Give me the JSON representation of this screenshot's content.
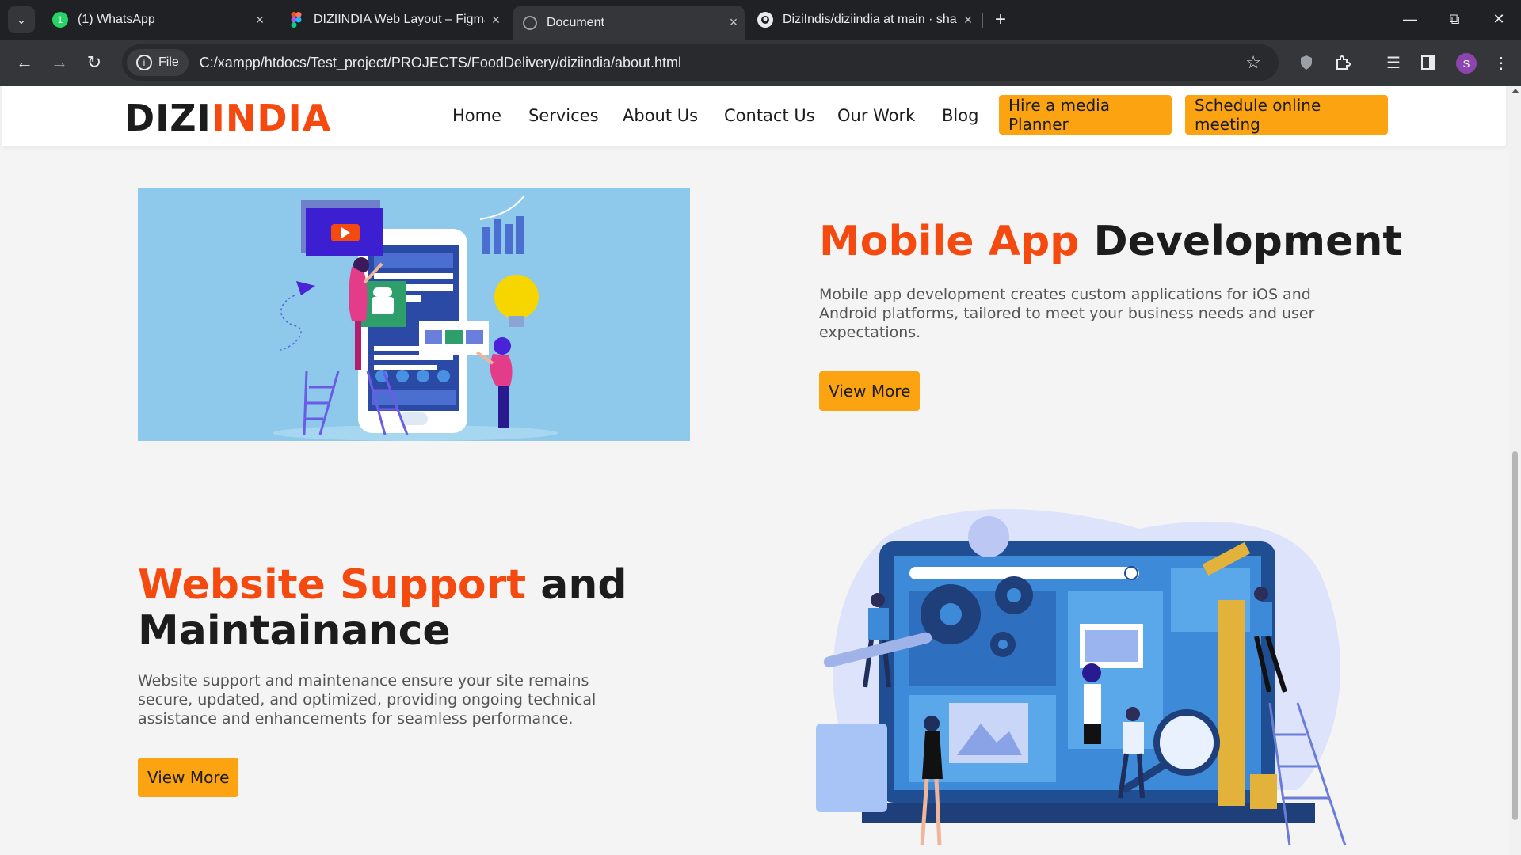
{
  "browser": {
    "tabs": [
      {
        "title": "(1) WhatsApp",
        "icon": "whatsapp-icon",
        "active": false
      },
      {
        "title": "DIZIINDIA Web Layout – Figma",
        "icon": "figma-icon",
        "active": false
      },
      {
        "title": "Document",
        "icon": "globe-icon",
        "active": true
      },
      {
        "title": "DiziIndis/diziindia at main · shar",
        "icon": "github-icon",
        "active": false
      }
    ],
    "new_tab": "+",
    "chip_label": "File",
    "url": "C:/xampp/htdocs/Test_project/PROJECTS/FoodDelivery/diziindia/about.html",
    "profile_initial": "S",
    "whatsapp_badge": "1"
  },
  "site": {
    "logo_part1": "DIZI",
    "logo_part2": "INDIA",
    "nav": [
      "Home",
      "Services",
      "About Us",
      "Contact Us",
      "Our Work",
      "Blog"
    ],
    "cta_planner": "Hire a media Planner",
    "cta_meeting": "Schedule online meeting",
    "brand_orange": "#f54a0f",
    "accent_yellow": "#fca311"
  },
  "section_mobile": {
    "title_highlight": "Mobile App",
    "title_rest": "Development",
    "text": "Mobile app development creates custom applications for iOS and Android platforms, tailored to meet your business needs and user expectations.",
    "button": "View More"
  },
  "section_website": {
    "title_highlight": "Website Support",
    "title_rest_1": "and",
    "title_rest_2": "Maintainance",
    "text": "Website support and maintenance ensure your site remains secure, updated, and optimized, providing ongoing technical assistance and enhancements for seamless performance.",
    "button": "View More"
  }
}
